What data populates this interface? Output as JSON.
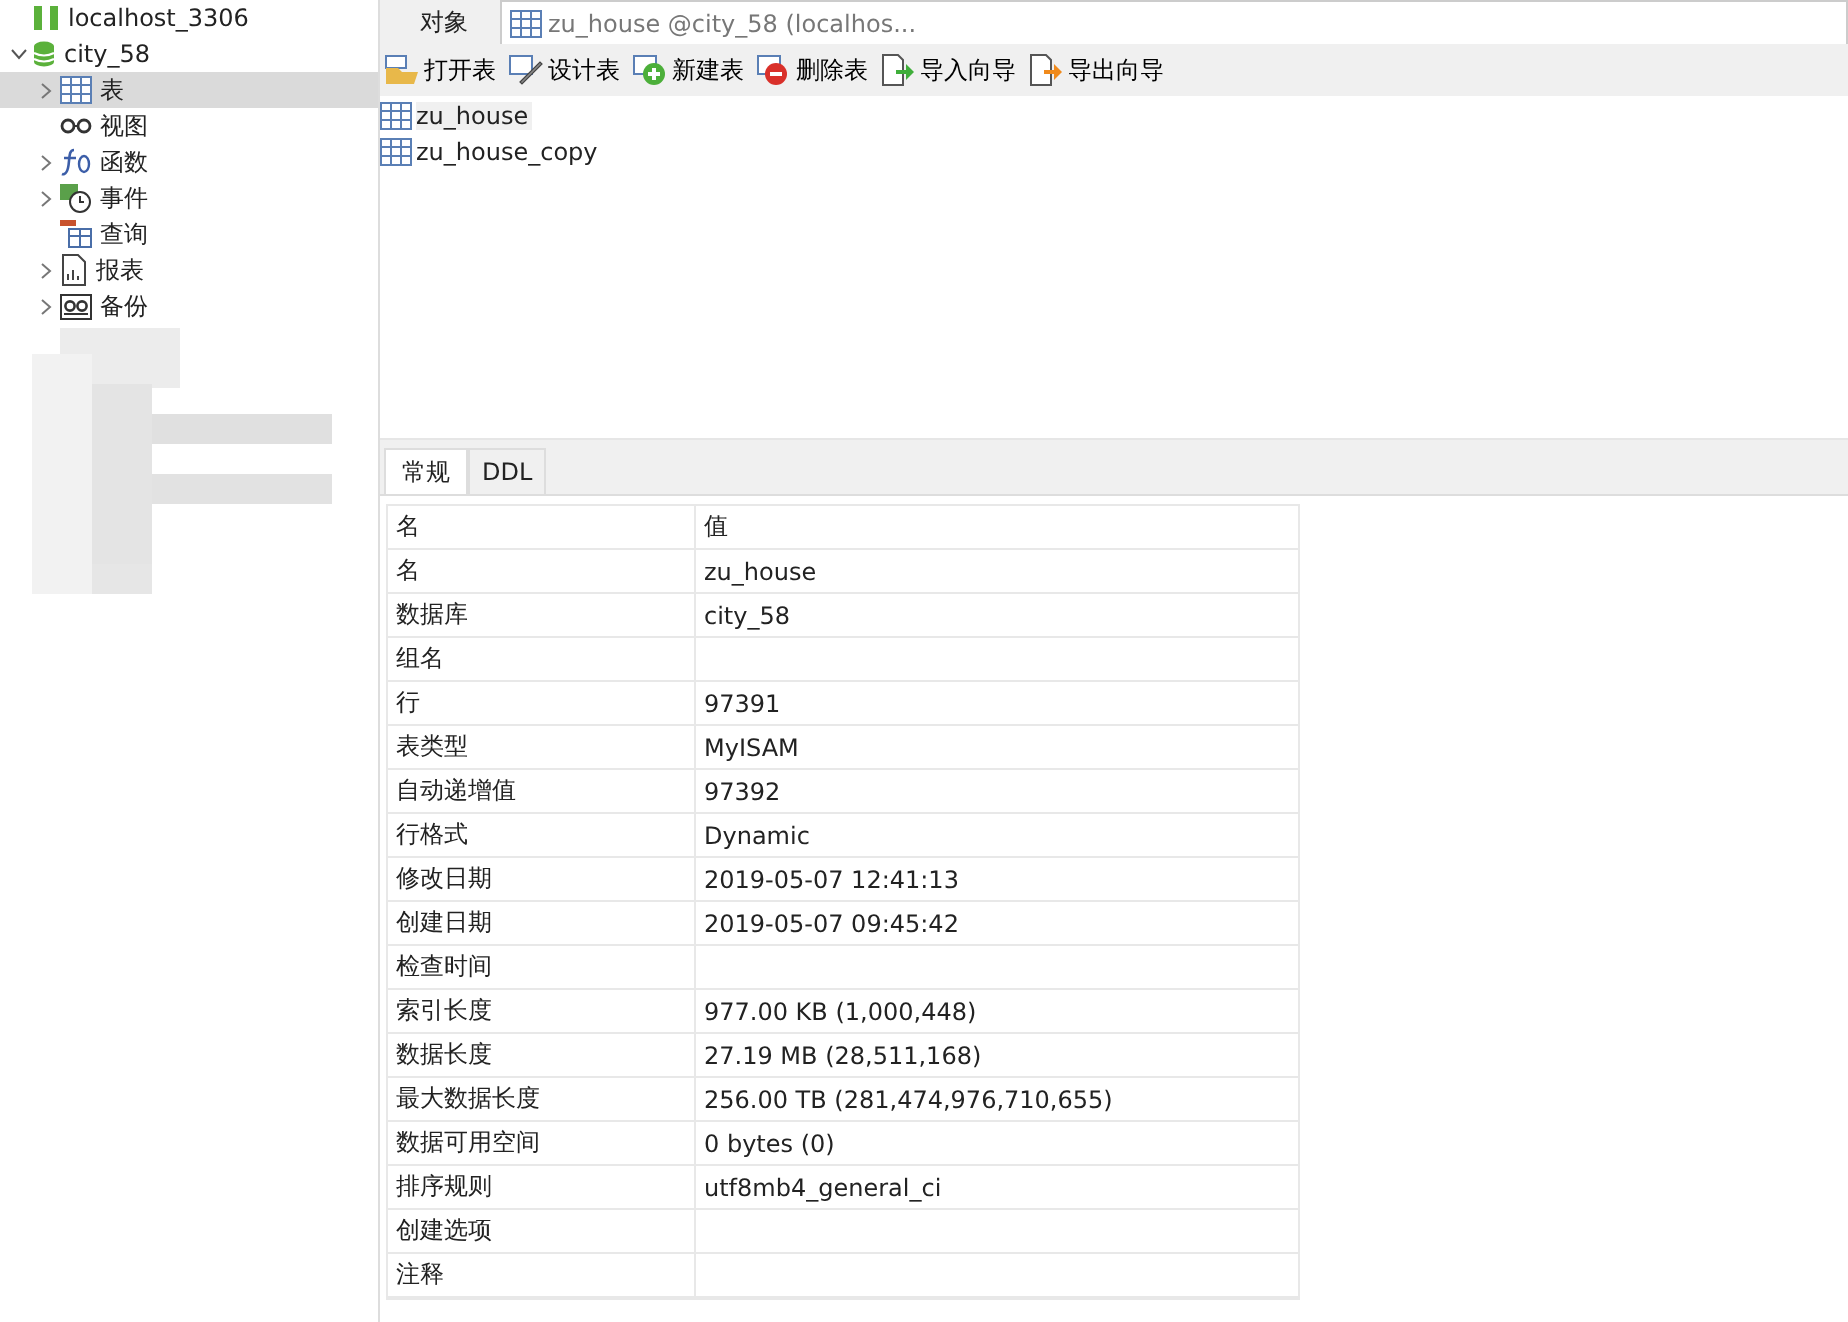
{
  "sidebar": {
    "connection": {
      "label": "localhost_3306"
    },
    "database": {
      "label": "city_58",
      "expanded": true
    },
    "items": [
      {
        "label": "表",
        "kind": "table",
        "expandable": true,
        "selected": true
      },
      {
        "label": "视图",
        "kind": "view",
        "expandable": false,
        "selected": false
      },
      {
        "label": "函数",
        "kind": "function",
        "expandable": true,
        "selected": false
      },
      {
        "label": "事件",
        "kind": "event",
        "expandable": true,
        "selected": false
      },
      {
        "label": "查询",
        "kind": "query",
        "expandable": false,
        "selected": false
      },
      {
        "label": "报表",
        "kind": "report",
        "expandable": true,
        "selected": false
      },
      {
        "label": "备份",
        "kind": "backup",
        "expandable": true,
        "selected": false
      }
    ]
  },
  "tabs": [
    {
      "label": "对象",
      "kind": "plain",
      "selected": false
    },
    {
      "label": "zu_house @city_58 (localhos...",
      "kind": "table",
      "selected": true
    }
  ],
  "toolbar": [
    {
      "label": "打开表",
      "kind": "open"
    },
    {
      "label": "设计表",
      "kind": "design"
    },
    {
      "label": "新建表",
      "kind": "new"
    },
    {
      "label": "删除表",
      "kind": "delete"
    },
    {
      "label": "导入向导",
      "kind": "import"
    },
    {
      "label": "导出向导",
      "kind": "export"
    }
  ],
  "tables": [
    {
      "name": "zu_house",
      "selected": true
    },
    {
      "name": "zu_house_copy",
      "selected": false
    }
  ],
  "info_tabs": [
    {
      "label": "常规",
      "selected": true
    },
    {
      "label": "DDL",
      "selected": false
    }
  ],
  "properties": {
    "columns": [
      "名",
      "值"
    ],
    "rows": [
      [
        "名",
        "zu_house"
      ],
      [
        "数据库",
        "city_58"
      ],
      [
        "组名",
        ""
      ],
      [
        "行",
        "97391"
      ],
      [
        "表类型",
        "MyISAM"
      ],
      [
        "自动递增值",
        "97392"
      ],
      [
        "行格式",
        "Dynamic"
      ],
      [
        "修改日期",
        "2019-05-07 12:41:13"
      ],
      [
        "创建日期",
        "2019-05-07 09:45:42"
      ],
      [
        "检查时间",
        ""
      ],
      [
        "索引长度",
        "977.00 KB (1,000,448)"
      ],
      [
        "数据长度",
        "27.19 MB (28,511,168)"
      ],
      [
        "最大数据长度",
        "256.00 TB (281,474,976,710,655)"
      ],
      [
        "数据可用空间",
        "0 bytes (0)"
      ],
      [
        "排序规则",
        "utf8mb4_general_ci"
      ],
      [
        "创建选项",
        ""
      ],
      [
        "注释",
        ""
      ]
    ]
  }
}
